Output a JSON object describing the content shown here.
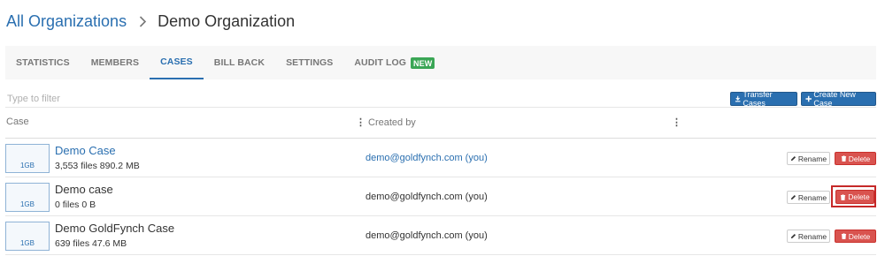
{
  "breadcrumb": {
    "parent": "All Organizations",
    "current": "Demo Organization"
  },
  "tabs": [
    {
      "label": "STATISTICS"
    },
    {
      "label": "MEMBERS"
    },
    {
      "label": "CASES",
      "active": true
    },
    {
      "label": "BILL BACK"
    },
    {
      "label": "SETTINGS"
    },
    {
      "label": "AUDIT LOG",
      "badge": "NEW"
    }
  ],
  "filter": {
    "placeholder": "Type to filter"
  },
  "toolbar": {
    "transfer_label": "Transfer Cases",
    "create_label": "Create New Case"
  },
  "columns": {
    "case": "Case",
    "created_by": "Created by"
  },
  "cases": [
    {
      "icon_label": "1GB",
      "name": "Demo Case",
      "meta": "3,553 files  890.2 MB",
      "created_by": "demo@goldfynch.com (you)",
      "rename": "Rename",
      "delete": "Delete"
    },
    {
      "icon_label": "1GB",
      "name": "Demo case",
      "meta": "0 files  0 B",
      "created_by": "demo@goldfynch.com (you)",
      "rename": "Rename",
      "delete": "Delete"
    },
    {
      "icon_label": "1GB",
      "name": "Demo GoldFynch Case",
      "meta": "639 files  47.6 MB",
      "created_by": "demo@goldfynch.com (you)",
      "rename": "Rename",
      "delete": "Delete"
    }
  ],
  "colors": {
    "accent": "#2a6fb0",
    "danger": "#d9534f",
    "badge": "#3aa655"
  }
}
